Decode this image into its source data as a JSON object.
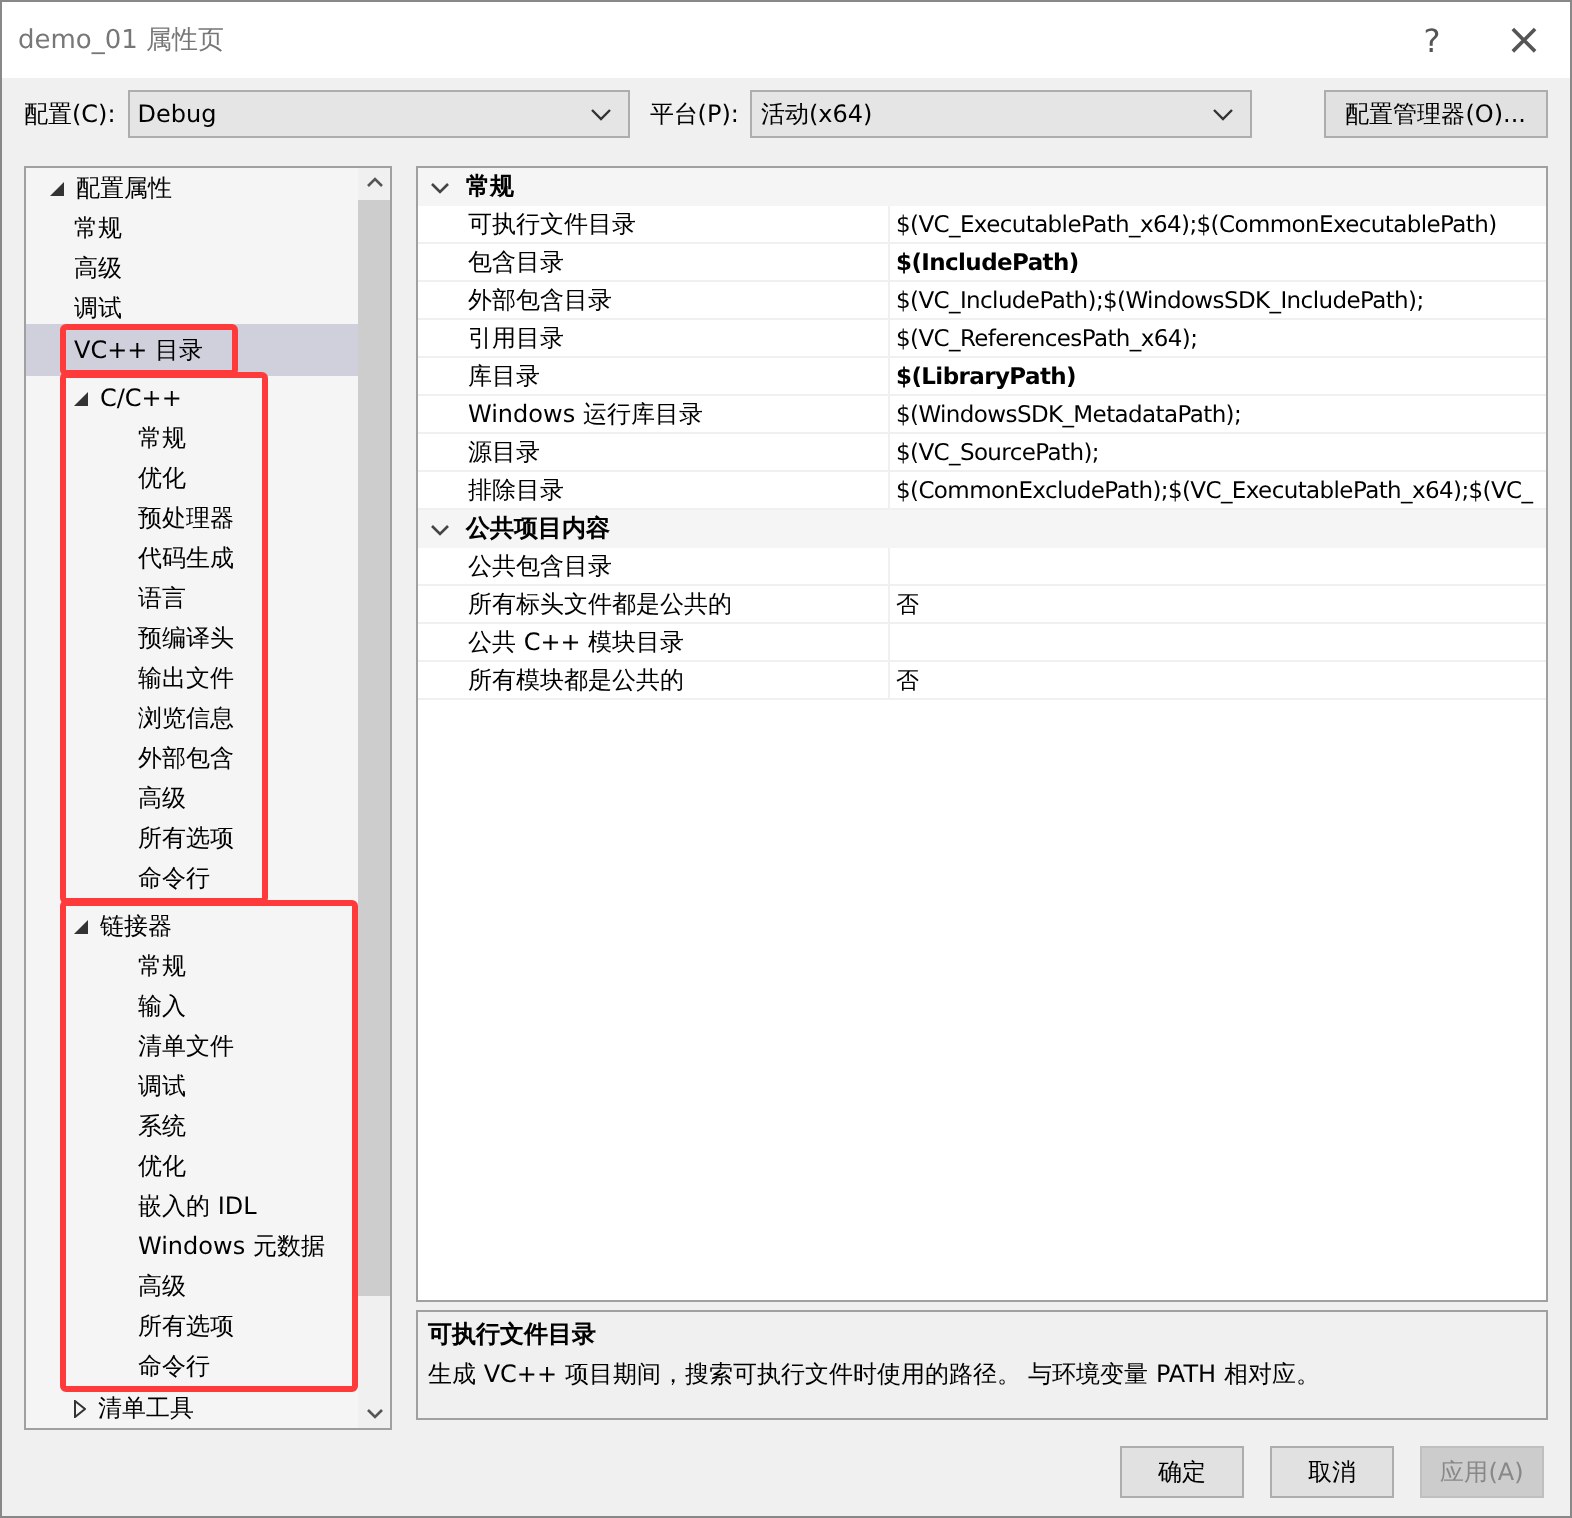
{
  "window": {
    "title": "demo_01 属性页",
    "help": "?",
    "close": "×"
  },
  "toolbar": {
    "config_label": "配置(C):",
    "config_value": "Debug",
    "platform_label": "平台(P):",
    "platform_value": "活动(x64)",
    "manager_button": "配置管理器(O)..."
  },
  "tree": [
    {
      "label": "配置属性",
      "expanded": true,
      "selected": false,
      "children": [
        {
          "label": "常规",
          "selected": false,
          "highlighted": false
        },
        {
          "label": "高级",
          "selected": false,
          "highlighted": false
        },
        {
          "label": "调试",
          "selected": false,
          "highlighted": false
        },
        {
          "label": "VC++ 目录",
          "selected": true,
          "highlighted": true
        },
        {
          "label": "C/C++",
          "expanded": true,
          "selected": false,
          "highlighted": true,
          "children": [
            {
              "label": "常规",
              "selected": false
            },
            {
              "label": "优化",
              "selected": false
            },
            {
              "label": "预处理器",
              "selected": false
            },
            {
              "label": "代码生成",
              "selected": false
            },
            {
              "label": "语言",
              "selected": false
            },
            {
              "label": "预编译头",
              "selected": false
            },
            {
              "label": "输出文件",
              "selected": false
            },
            {
              "label": "浏览信息",
              "selected": false
            },
            {
              "label": "外部包含",
              "selected": false
            },
            {
              "label": "高级",
              "selected": false
            },
            {
              "label": "所有选项",
              "selected": false
            },
            {
              "label": "命令行",
              "selected": false
            }
          ]
        },
        {
          "label": "链接器",
          "expanded": true,
          "selected": false,
          "highlighted": true,
          "children": [
            {
              "label": "常规",
              "selected": false
            },
            {
              "label": "输入",
              "selected": false
            },
            {
              "label": "清单文件",
              "selected": false
            },
            {
              "label": "调试",
              "selected": false
            },
            {
              "label": "系统",
              "selected": false
            },
            {
              "label": "优化",
              "selected": false
            },
            {
              "label": "嵌入的 IDL",
              "selected": false
            },
            {
              "label": "Windows 元数据",
              "selected": false
            },
            {
              "label": "高级",
              "selected": false
            },
            {
              "label": "所有选项",
              "selected": false
            },
            {
              "label": "命令行",
              "selected": false
            }
          ]
        },
        {
          "label": "清单工具",
          "expanded": false,
          "selected": false,
          "highlighted": false
        }
      ]
    }
  ],
  "grid": [
    {
      "category": "常规",
      "expanded": true,
      "rows": [
        {
          "name": "可执行文件目录",
          "value": "$(VC_ExecutablePath_x64);$(CommonExecutablePath)",
          "bold": false
        },
        {
          "name": "包含目录",
          "value": "$(IncludePath)",
          "bold": true
        },
        {
          "name": "外部包含目录",
          "value": "$(VC_IncludePath);$(WindowsSDK_IncludePath);",
          "bold": false
        },
        {
          "name": "引用目录",
          "value": "$(VC_ReferencesPath_x64);",
          "bold": false
        },
        {
          "name": "库目录",
          "value": "$(LibraryPath)",
          "bold": true
        },
        {
          "name": "Windows 运行库目录",
          "value": "$(WindowsSDK_MetadataPath);",
          "bold": false
        },
        {
          "name": "源目录",
          "value": "$(VC_SourcePath);",
          "bold": false
        },
        {
          "name": "排除目录",
          "value": "$(CommonExcludePath);$(VC_ExecutablePath_x64);$(VC_",
          "bold": false
        }
      ]
    },
    {
      "category": "公共项目内容",
      "expanded": true,
      "rows": [
        {
          "name": "公共包含目录",
          "bold": false
        },
        {
          "name": "所有标头文件都是公共的",
          "value": "否",
          "bold": false
        },
        {
          "name": "公共 C++ 模块目录",
          "bold": false
        },
        {
          "name": "所有模块都是公共的",
          "value": "否",
          "bold": false
        }
      ]
    }
  ],
  "description": {
    "title": "可执行文件目录",
    "text": "生成 VC++ 项目期间，搜索可执行文件时使用的路径。 与环境变量 PATH 相对应。"
  },
  "buttons": [
    {
      "label": "确定",
      "disabled": false
    },
    {
      "label": "取消",
      "disabled": false
    },
    {
      "label": "应用(A)",
      "disabled": true
    }
  ]
}
